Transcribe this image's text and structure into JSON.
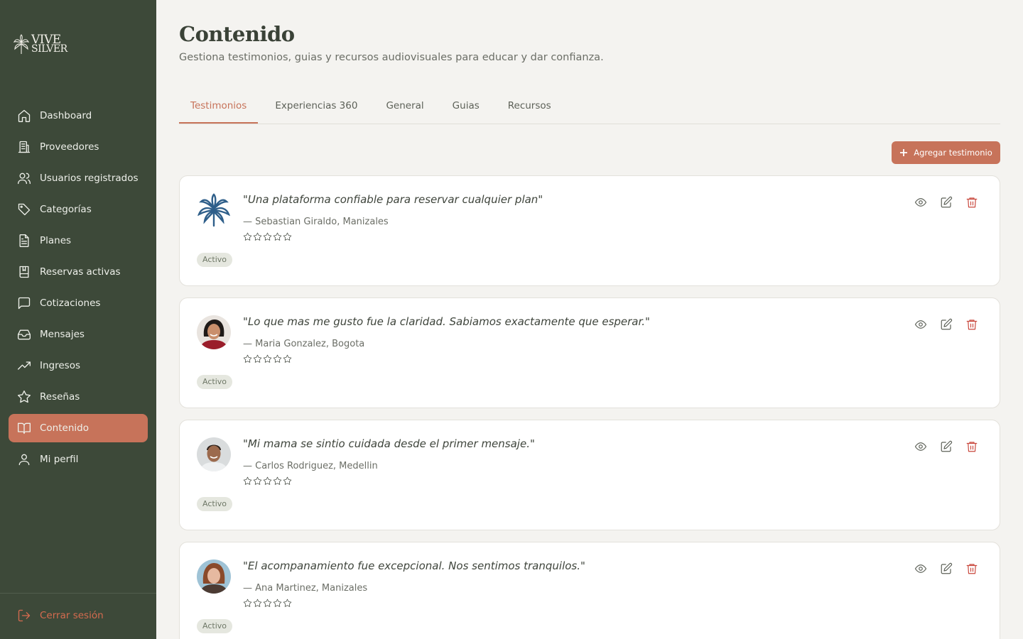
{
  "brand": {
    "line1": "VIVE",
    "line2": "SILVER"
  },
  "sidebar": {
    "items": [
      {
        "label": "Dashboard",
        "icon": "home-icon"
      },
      {
        "label": "Proveedores",
        "icon": "building-icon"
      },
      {
        "label": "Usuarios registrados",
        "icon": "users-icon"
      },
      {
        "label": "Categorías",
        "icon": "tag-icon"
      },
      {
        "label": "Planes",
        "icon": "file-icon"
      },
      {
        "label": "Reservas activas",
        "icon": "book-bookmark-icon"
      },
      {
        "label": "Cotizaciones",
        "icon": "message-square-icon"
      },
      {
        "label": "Mensajes",
        "icon": "inbox-icon"
      },
      {
        "label": "Ingresos",
        "icon": "trending-up-icon"
      },
      {
        "label": "Reseñas",
        "icon": "star-icon"
      },
      {
        "label": "Contenido",
        "icon": "book-open-icon",
        "active": true
      },
      {
        "label": "Mi perfil",
        "icon": "user-icon"
      }
    ],
    "logout": "Cerrar sesión"
  },
  "page": {
    "title": "Contenido",
    "subtitle": "Gestiona testimonios, guias y recursos audiovisuales para educar y dar confianza."
  },
  "tabs": [
    {
      "label": "Testimonios",
      "active": true
    },
    {
      "label": "Experiencias 360"
    },
    {
      "label": "General"
    },
    {
      "label": "Guias"
    },
    {
      "label": "Recursos"
    }
  ],
  "add_button": "Agregar testimonio",
  "testimonials": [
    {
      "quote": "\"Una plataforma confiable para reservar cualquier plan\"",
      "author": "— Sebastian Giraldo, Manizales",
      "rating": 0,
      "status": "Activo",
      "avatar": "palm-logo"
    },
    {
      "quote": "\"Lo que mas me gusto fue la claridad. Sabiamos exactamente que esperar.\"",
      "author": "— Maria Gonzalez, Bogota",
      "rating": 0,
      "status": "Activo",
      "avatar": "woman-photo"
    },
    {
      "quote": "\"Mi mama se sintio cuidada desde el primer mensaje.\"",
      "author": "— Carlos Rodriguez, Medellin",
      "rating": 0,
      "status": "Activo",
      "avatar": "man-photo"
    },
    {
      "quote": "\"El acompanamiento fue excepcional. Nos sentimos tranquilos.\"",
      "author": "— Ana Martinez, Manizales",
      "rating": 0,
      "status": "Activo",
      "avatar": "woman-photo"
    }
  ],
  "colors": {
    "sidebar": "#3d4939",
    "accent": "#c7735a",
    "delete": "#c9483d",
    "background": "#f4f3f0"
  }
}
